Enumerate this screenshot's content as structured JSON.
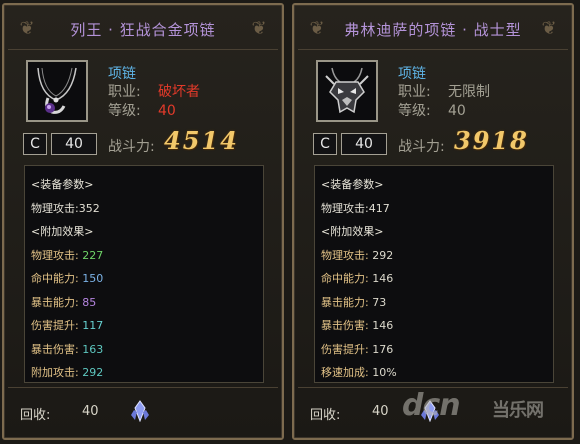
{
  "left": {
    "title": "列王 · 狂战合金项链",
    "item_type": "项链",
    "class_label": "职业:",
    "class_value": "破坏者",
    "class_color": "#e23a2a",
    "level_label": "等级:",
    "level_value": "40",
    "level_color": "#e23a2a",
    "grade": "C",
    "grade_level": "40",
    "power_label": "战斗力:",
    "power_value": "4514",
    "stats": [
      {
        "type": "header",
        "text": "<装备参数>"
      },
      {
        "type": "plain",
        "text": "物理攻击:352"
      },
      {
        "type": "header",
        "text": "<附加效果>"
      },
      {
        "type": "bonus",
        "name": "物理攻击:",
        "value": "227",
        "color": "green"
      },
      {
        "type": "bonus",
        "name": "命中能力:",
        "value": "150",
        "color": "blue"
      },
      {
        "type": "bonus",
        "name": "暴击能力:",
        "value": "85",
        "color": "purple"
      },
      {
        "type": "bonus",
        "name": "伤害提升:",
        "value": "117",
        "color": "cyan"
      },
      {
        "type": "bonus",
        "name": "暴击伤害:",
        "value": "163",
        "color": "teal"
      },
      {
        "type": "bonus",
        "name": "附加攻击:",
        "value": "292",
        "color": "teal"
      }
    ],
    "recycle_label": "回收:",
    "recycle_value": "40",
    "icon": "necklace-icon"
  },
  "right": {
    "title": "弗林迪萨的项链 · 战士型",
    "item_type": "项链",
    "class_label": "职业:",
    "class_value": "无限制",
    "class_color": "#a3a093",
    "level_label": "等级:",
    "level_value": "40",
    "level_color": "#a3a093",
    "grade": "C",
    "grade_level": "40",
    "power_label": "战斗力:",
    "power_value": "3918",
    "stats": [
      {
        "type": "header",
        "text": "<装备参数>"
      },
      {
        "type": "plain",
        "text": "物理攻击:417"
      },
      {
        "type": "header",
        "text": "<附加效果>"
      },
      {
        "type": "bonus",
        "name": "物理攻击:",
        "value": "292",
        "color": "white"
      },
      {
        "type": "bonus",
        "name": "命中能力:",
        "value": "146",
        "color": "white"
      },
      {
        "type": "bonus",
        "name": "暴击能力:",
        "value": "73",
        "color": "white"
      },
      {
        "type": "bonus",
        "name": "暴击伤害:",
        "value": "146",
        "color": "white"
      },
      {
        "type": "bonus",
        "name": "伤害提升:",
        "value": "176",
        "color": "white"
      },
      {
        "type": "bonus",
        "name": "移速加成:",
        "value": "10%",
        "color": "white"
      }
    ],
    "recycle_label": "回收:",
    "recycle_value": "40",
    "icon": "skull-amulet-icon"
  },
  "watermark": {
    "main": "dcn",
    "sub": "当乐网"
  }
}
